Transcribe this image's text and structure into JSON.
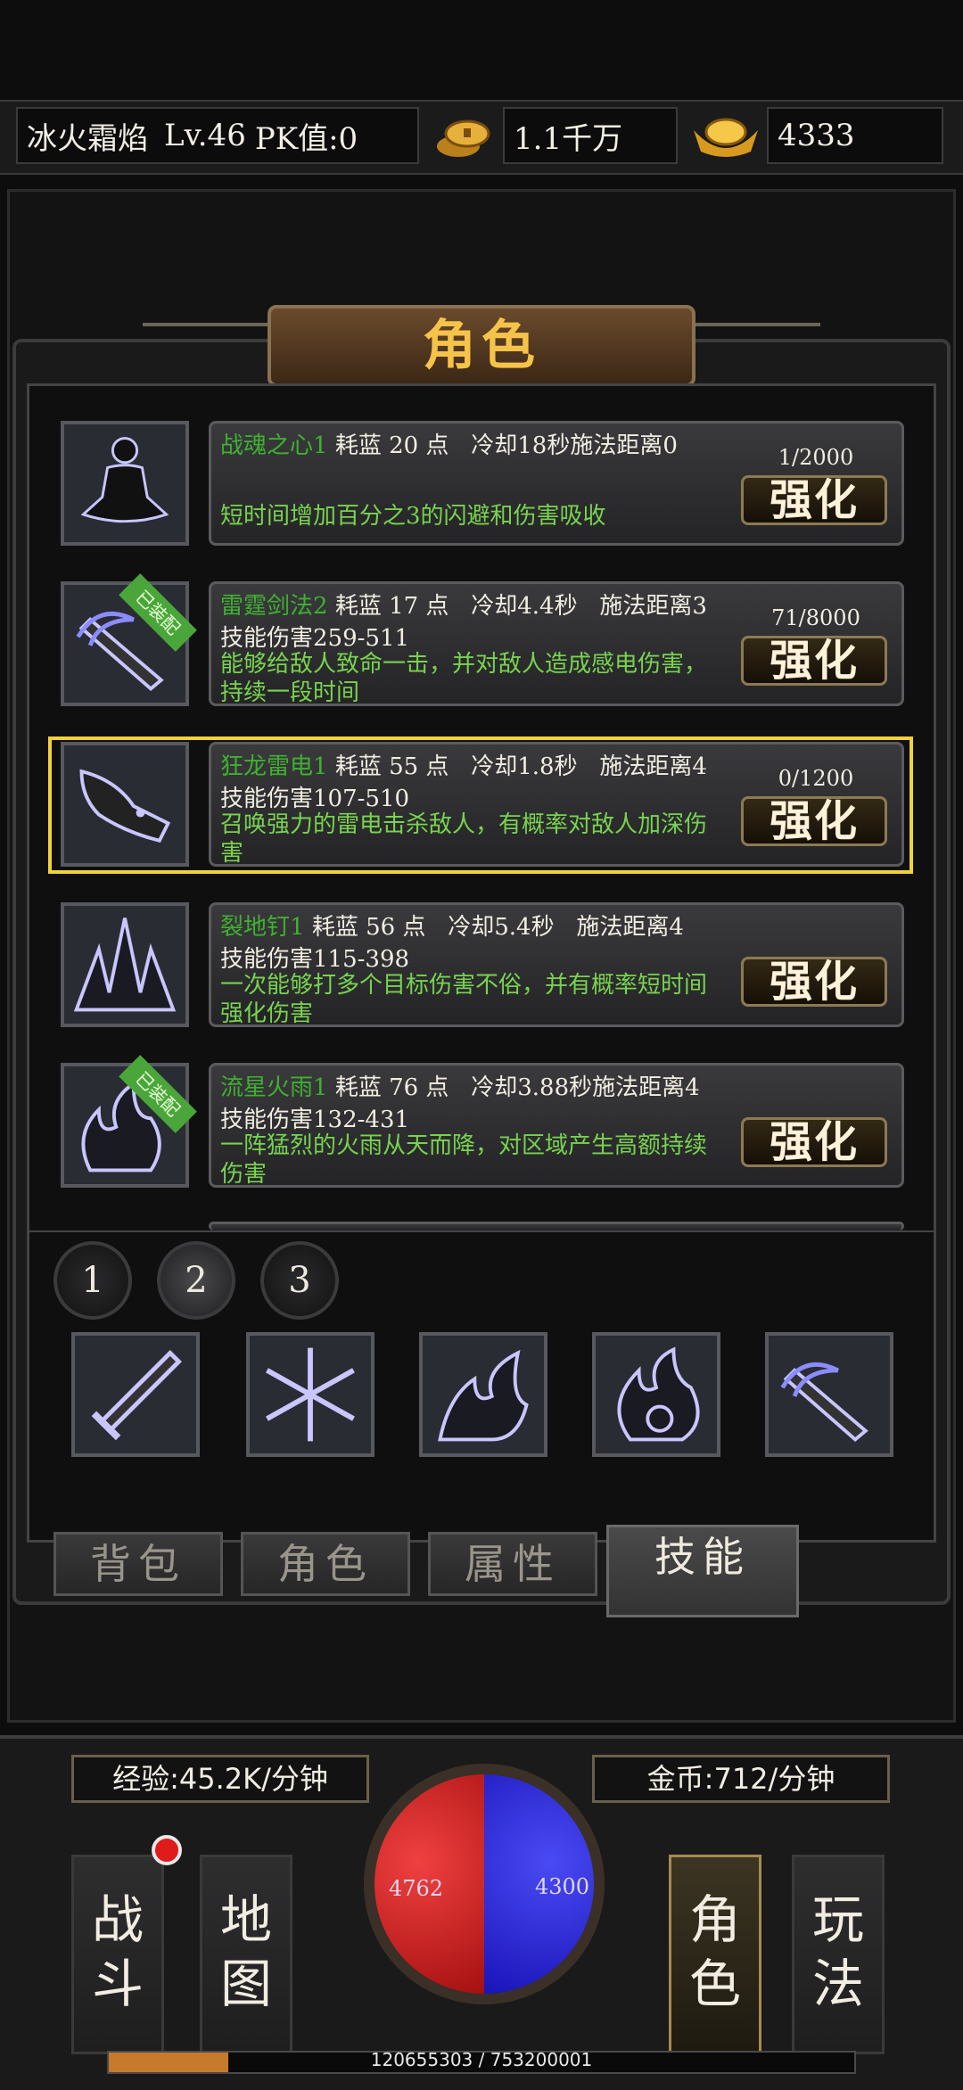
{
  "header": {
    "player": "冰火霜焰",
    "level": "Lv.46",
    "pk": "PK值:0",
    "gold": "1.1千万",
    "ingot": "4333"
  },
  "panel_title": "角色",
  "skills": [
    {
      "name": "战魂之心1",
      "cost": "耗蓝 20 点",
      "cd": "冷却18秒",
      "range": "施法距离0",
      "dmg": "",
      "desc": "短时间增加百分之3的闪避和伤害吸收",
      "progress": "1/2000",
      "btn": "强化",
      "equipped": false
    },
    {
      "name": "雷霆剑法2",
      "cost": "耗蓝 17 点",
      "cd": "冷却4.4秒",
      "range": "施法距离3",
      "dmg": "技能伤害259-511",
      "desc": "能够给敌人致命一击，并对敌人造成感电伤害，持续一段时间",
      "progress": "71/8000",
      "btn": "强化",
      "equipped": true
    },
    {
      "name": "狂龙雷电1",
      "cost": "耗蓝 55 点",
      "cd": "冷却1.8秒",
      "range": "施法距离4",
      "dmg": "技能伤害107-510",
      "desc": "召唤强力的雷电击杀敌人，有概率对敌人加深伤害",
      "progress": "0/1200",
      "btn": "强化",
      "equipped": false
    },
    {
      "name": "裂地钉1",
      "cost": "耗蓝 56 点",
      "cd": "冷却5.4秒",
      "range": "施法距离4",
      "dmg": "技能伤害115-398",
      "desc": "一次能够打多个目标伤害不俗，并有概率短时间强化伤害",
      "progress": "",
      "btn": "强化",
      "equipped": false
    },
    {
      "name": "流星火雨1",
      "cost": "耗蓝 76 点",
      "cd": "冷却3.88秒",
      "range": "施法距离4",
      "dmg": "技能伤害132-431",
      "desc": "一阵猛烈的火雨从天而降，对区域产生高额持续伤害",
      "progress": "",
      "btn": "强化",
      "equipped": true
    }
  ],
  "equipped_badge": "已装配",
  "pages": [
    "1",
    "2",
    "3"
  ],
  "slot_icons": [
    "sword-icon",
    "snowflake-icon",
    "fire-claw-icon",
    "flame-swirl-icon",
    "thunder-sword-icon"
  ],
  "tabs": [
    "背包",
    "角色",
    "属性",
    "技能"
  ],
  "active_tab": "技能",
  "hud": {
    "exp_rate": "经验:45.2K/分钟",
    "gold_rate": "金币:712/分钟",
    "hp": "4762",
    "mp": "4300",
    "exp_text": "120655303 / 753200001",
    "exp_fraction": 0.16,
    "buttons": [
      {
        "label": "战斗"
      },
      {
        "label": "地图"
      },
      {
        "label": "角色"
      },
      {
        "label": "玩法"
      }
    ]
  },
  "colors": {
    "skill_name": "#3fb030",
    "desc": "#78d34f",
    "title": "#f6c34a",
    "selected": "#f2d23b"
  }
}
